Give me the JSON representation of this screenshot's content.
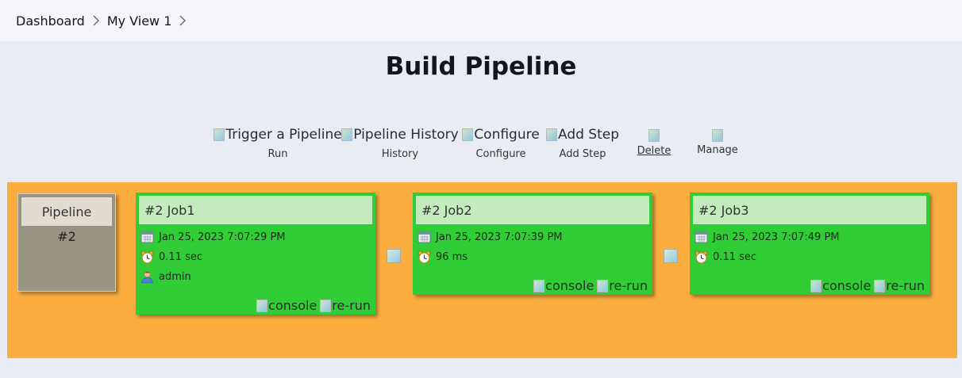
{
  "breadcrumb": {
    "items": [
      "Dashboard",
      "My View 1"
    ]
  },
  "page": {
    "title": "Build Pipeline"
  },
  "toolbar": {
    "run": {
      "alt": "Trigger a Pipeline",
      "label": "Run"
    },
    "history": {
      "alt": "Pipeline History",
      "label": "History"
    },
    "configure": {
      "alt": "Configure",
      "label": "Configure"
    },
    "add_step": {
      "alt": "Add Step",
      "label": "Add Step"
    },
    "delete": {
      "label": "Delete"
    },
    "manage": {
      "label": "Manage"
    }
  },
  "pipeline": {
    "label": "Pipeline",
    "number": "#2"
  },
  "jobs": [
    {
      "title": "#2 Job1",
      "date": "Jan 25, 2023 7:07:29 PM",
      "duration": "0.11 sec",
      "user": "admin",
      "console": "console",
      "rerun": "re-run"
    },
    {
      "title": "#2 Job2",
      "date": "Jan 25, 2023 7:07:39 PM",
      "duration": "96 ms",
      "console": "console",
      "rerun": "re-run"
    },
    {
      "title": "#2 Job3",
      "date": "Jan 25, 2023 7:07:49 PM",
      "duration": "0.11 sec",
      "console": "console",
      "rerun": "re-run"
    }
  ],
  "colors": {
    "band": "#fbad3f",
    "job_success": "#31cd37",
    "job_header": "#c3ebbe",
    "pipeline_box": "#9a9283"
  },
  "icons": {
    "calendar": "calendar-icon",
    "clock": "clock-icon",
    "user": "user-icon"
  }
}
